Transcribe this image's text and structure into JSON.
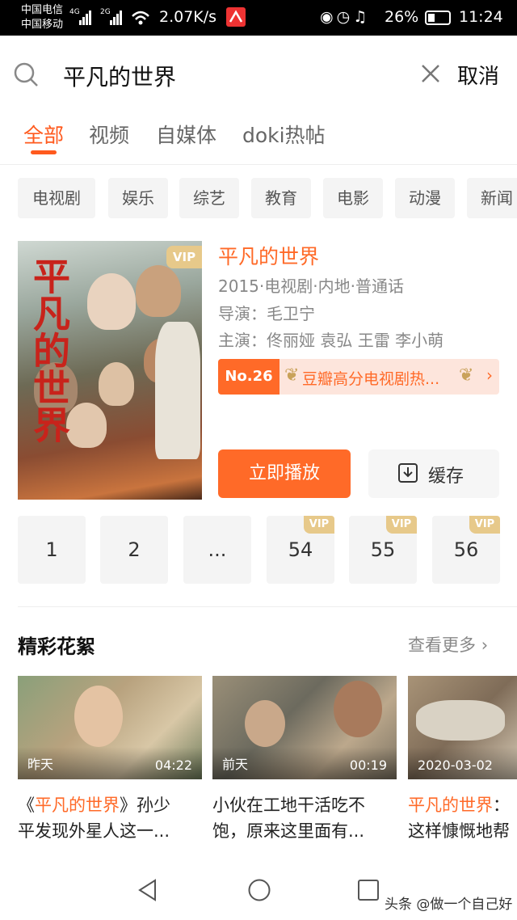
{
  "status_bar": {
    "carrier1": "中国电信",
    "carrier2": "中国移动",
    "net1": "4G",
    "net2": "2G",
    "speed": "2.07K/s",
    "battery": "26%",
    "time": "11:24"
  },
  "search": {
    "query": "平凡的世界",
    "cancel_label": "取消"
  },
  "tabs": [
    "全部",
    "视频",
    "自媒体",
    "doki热帖"
  ],
  "categories": [
    "电视剧",
    "娱乐",
    "综艺",
    "教育",
    "电影",
    "动漫",
    "新闻"
  ],
  "result": {
    "poster_title": "平凡的世界",
    "vip": "VIP",
    "title": "平凡的世界",
    "meta": "2015·电视剧·内地·普通话",
    "director": "导演：毛卫宁",
    "cast": "主演：佟丽娅 袁弘 王雷 李小萌",
    "rank_no": "No.26",
    "rank_text": "豆瓣高分电视剧热...",
    "play_label": "立即播放",
    "cache_label": "缓存"
  },
  "episodes": [
    {
      "label": "1",
      "vip": ""
    },
    {
      "label": "2",
      "vip": ""
    },
    {
      "label": "...",
      "vip": ""
    },
    {
      "label": "54",
      "vip": "VIP"
    },
    {
      "label": "55",
      "vip": "VIP"
    },
    {
      "label": "56",
      "vip": "VIP"
    }
  ],
  "highlights": {
    "title": "精彩花絮",
    "more_label": "查看更多",
    "clips": [
      {
        "time": "昨天",
        "duration": "04:22",
        "line1_pre": "《",
        "line1_hl": "平凡的世界",
        "line1_post": "》孙少",
        "line2": "平发现外星人这一..."
      },
      {
        "time": "前天",
        "duration": "00:19",
        "line1_pre": "小伙在工地干活吃不",
        "line1_hl": "",
        "line1_post": "",
        "line2": "饱，原来这里面有..."
      },
      {
        "time": "2020-03-02",
        "duration": "",
        "line1_pre": "",
        "line1_hl": "平凡的世界",
        "line1_post": "：",
        "line2": "这样慷慨地帮"
      }
    ]
  },
  "watermark": "头条 @做一个自己好",
  "colors": {
    "accent": "#ff6a28",
    "tab_active": "#ff5a1e",
    "vip": "#e7c98a"
  }
}
